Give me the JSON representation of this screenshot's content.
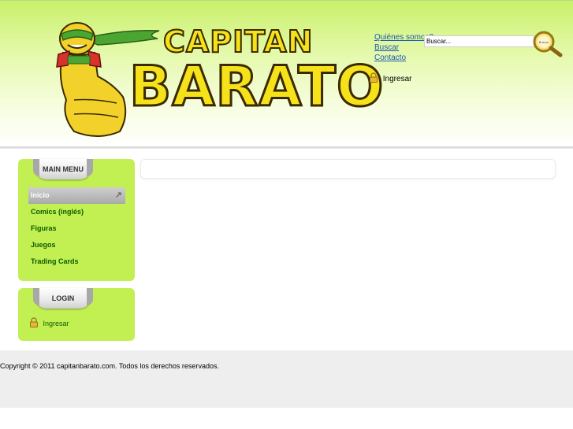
{
  "logo": {
    "line1": "CAPITAN",
    "line2": "BARATO"
  },
  "top_links": [
    "Quiénes somos?",
    "Buscar",
    "Contacto"
  ],
  "search": {
    "value": "Buscar...",
    "button_label": "Buscar",
    "button_icon": "magnifier-icon"
  },
  "header_login": {
    "icon": "lock-icon",
    "label": "Ingresar"
  },
  "main_menu": {
    "title": "MAIN MENU",
    "items": [
      {
        "label": "Inicio",
        "active": true,
        "arrow": "↗"
      },
      {
        "label": "Comics (inglés)"
      },
      {
        "label": "Figuras"
      },
      {
        "label": "Juegos"
      },
      {
        "label": "Trading Cards"
      }
    ]
  },
  "login_module": {
    "title": "LOGIN",
    "icon": "lock-icon",
    "label": "Ingresar"
  },
  "footer": {
    "copyright": "Copyright © 2011 capitanbarato.com. Todos los derechos reservados."
  },
  "colors": {
    "module_bg": "#c2f052",
    "link": "#1c57b8",
    "menu_text": "#0b5c00",
    "logo_fill": "#f5e21a"
  }
}
